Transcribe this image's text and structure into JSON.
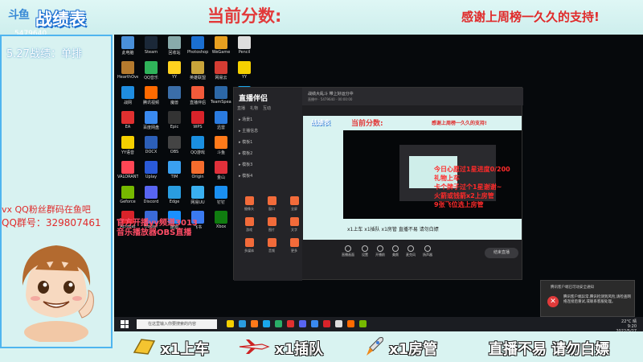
{
  "header": {
    "logo_text": "斗鱼",
    "title": "战绩表",
    "room_id": "5479640",
    "score_label": "当前分数:",
    "thanks": "感谢上周榜一久久的支持!"
  },
  "left_panel": {
    "record": "5.27战绩：单排",
    "vx_line": "vx QQ粉丝群码在鱼吧",
    "qq_line": "QQ群号：329807461"
  },
  "overlays": {
    "pink": [
      "官方开播yy频道3013",
      "音乐播放器OBS直播"
    ],
    "red_info": [
      "今日心愿过1星进度0/200",
      "礼物上车",
      "卡个牌子过个1星谢谢~",
      "火箭或钱箭x2上房管",
      "9张飞位选上房管"
    ]
  },
  "desktop_icons": [
    {
      "label": "此电脑",
      "color": "#4a90d9"
    },
    {
      "label": "Steam",
      "color": "#1b2838"
    },
    {
      "label": "回收站",
      "color": "#8aa"
    },
    {
      "label": "Photoshop",
      "color": "#1a6fd1"
    },
    {
      "label": "WeGame",
      "color": "#e8a020"
    },
    {
      "label": "Pencil",
      "color": "#ddd"
    },
    {
      "label": "HearthOverlay",
      "color": "#b47a2e"
    },
    {
      "label": "QQ音乐",
      "color": "#2fb35a"
    },
    {
      "label": "YY",
      "color": "#ffd21f"
    },
    {
      "label": "英雄联盟",
      "color": "#c9a43a"
    },
    {
      "label": "网易云",
      "color": "#d43c33"
    },
    {
      "label": "YY",
      "color": "#f5d000"
    },
    {
      "label": "战网",
      "color": "#1f8de0"
    },
    {
      "label": "腾讯视频",
      "color": "#ff6a00"
    },
    {
      "label": "魔兽",
      "color": "#3b6ea8"
    },
    {
      "label": "直播伴侣",
      "color": "#f25a3a"
    },
    {
      "label": "TeamSpeak",
      "color": "#2c67a6"
    },
    {
      "label": "QQ",
      "color": "#1aa7ec"
    },
    {
      "label": "EA",
      "color": "#e03030"
    },
    {
      "label": "百度网盘",
      "color": "#3a8af0"
    },
    {
      "label": "Epic",
      "color": "#333"
    },
    {
      "label": "WPS",
      "color": "#d8232a"
    },
    {
      "label": "迅雷",
      "color": "#2a7be0"
    },
    {
      "label": "Chrome",
      "color": "#e7b02a"
    },
    {
      "label": "YY语音",
      "color": "#f5d000"
    },
    {
      "label": "DOCX",
      "color": "#2c5fb8"
    },
    {
      "label": "OBS",
      "color": "#444"
    },
    {
      "label": "QQ游戏",
      "color": "#1a8fe0"
    },
    {
      "label": "斗鱼",
      "color": "#ff7a1a"
    },
    {
      "label": "Battle",
      "color": "#1663b8"
    },
    {
      "label": "VALORANT",
      "color": "#ff4655"
    },
    {
      "label": "Uplay",
      "color": "#2a5ad8"
    },
    {
      "label": "TIM",
      "color": "#3aa0f0"
    },
    {
      "label": "Origin",
      "color": "#f56c2d"
    },
    {
      "label": "金山",
      "color": "#e0303a"
    },
    {
      "label": "Rockstar",
      "color": "#fcaf17"
    },
    {
      "label": "Geforce",
      "color": "#76b900"
    },
    {
      "label": "Discord",
      "color": "#5865f2"
    },
    {
      "label": "Edge",
      "color": "#2a9de0"
    },
    {
      "label": "网易UU",
      "color": "#3ab0f0"
    },
    {
      "label": "钉钉",
      "color": "#1a8ff0"
    },
    {
      "label": "微信",
      "color": "#2aae67"
    },
    {
      "label": "Acrobat",
      "color": "#d8232a"
    },
    {
      "label": "Fiddler",
      "color": "#3a6ad8"
    },
    {
      "label": "酷狗",
      "color": "#1a90ff"
    },
    {
      "label": "飞书",
      "color": "#3a7af0"
    },
    {
      "label": "Xbox",
      "color": "#107c10"
    },
    {
      "label": "VLC",
      "color": "#ff8800"
    }
  ],
  "app": {
    "name": "直播伴侣",
    "tabs": [
      "直播",
      "礼物",
      "互动"
    ],
    "stream_title": "战绩大乱斗 带上好运分中",
    "stream_sub": "直播中 · 5479640 · 00:00:00",
    "rows": [
      "场景1",
      "主播信息",
      "模板1",
      "模板2",
      "模板3",
      "模板4"
    ],
    "tools": [
      "摄像头",
      "窗口",
      "全屏",
      "游戏",
      "图片",
      "文字",
      "多媒体",
      "音频",
      "更多"
    ],
    "controls": [
      "直播画面",
      "设置",
      "开播前",
      "美颜",
      "麦克风",
      "扬声器"
    ],
    "go_live": "结束直播",
    "preview": {
      "title": "战绩表",
      "score_label": "当前分数:",
      "thanks": "感谢上周榜一久久的支持!",
      "bottom": "x1上车  x1插队  x1房管   直播不易 请勿白嫖"
    }
  },
  "notification": {
    "title": "腾讯客户端已可动安全通知",
    "message": "腾讯客户端异常,腾讯检测到风险,请检查网络连接后重试,或联系客服处理。"
  },
  "taskbar": {
    "search_placeholder": "在这里输入你要搜索的内容",
    "tray_line1": "22°C 晴",
    "tray_time": "9:20",
    "tray_date": "2022/5/27",
    "app_colors": [
      "#f5d000",
      "#2a9de0",
      "#ff7a1a",
      "#1aa7ec",
      "#2aae67",
      "#e03030",
      "#5865f2",
      "#3a8af0",
      "#d8232a",
      "#ddd",
      "#ff6a00",
      "#76b900"
    ]
  },
  "bottom_bar": {
    "item1": "x1上车",
    "item2": "x1插队",
    "item3": "x1房管",
    "slogan": "直播不易 请勿白嫖"
  },
  "colors": {
    "accent_red": "#e02a2a",
    "panel_border": "#4fb5ef",
    "background": "#d9f3f1"
  }
}
